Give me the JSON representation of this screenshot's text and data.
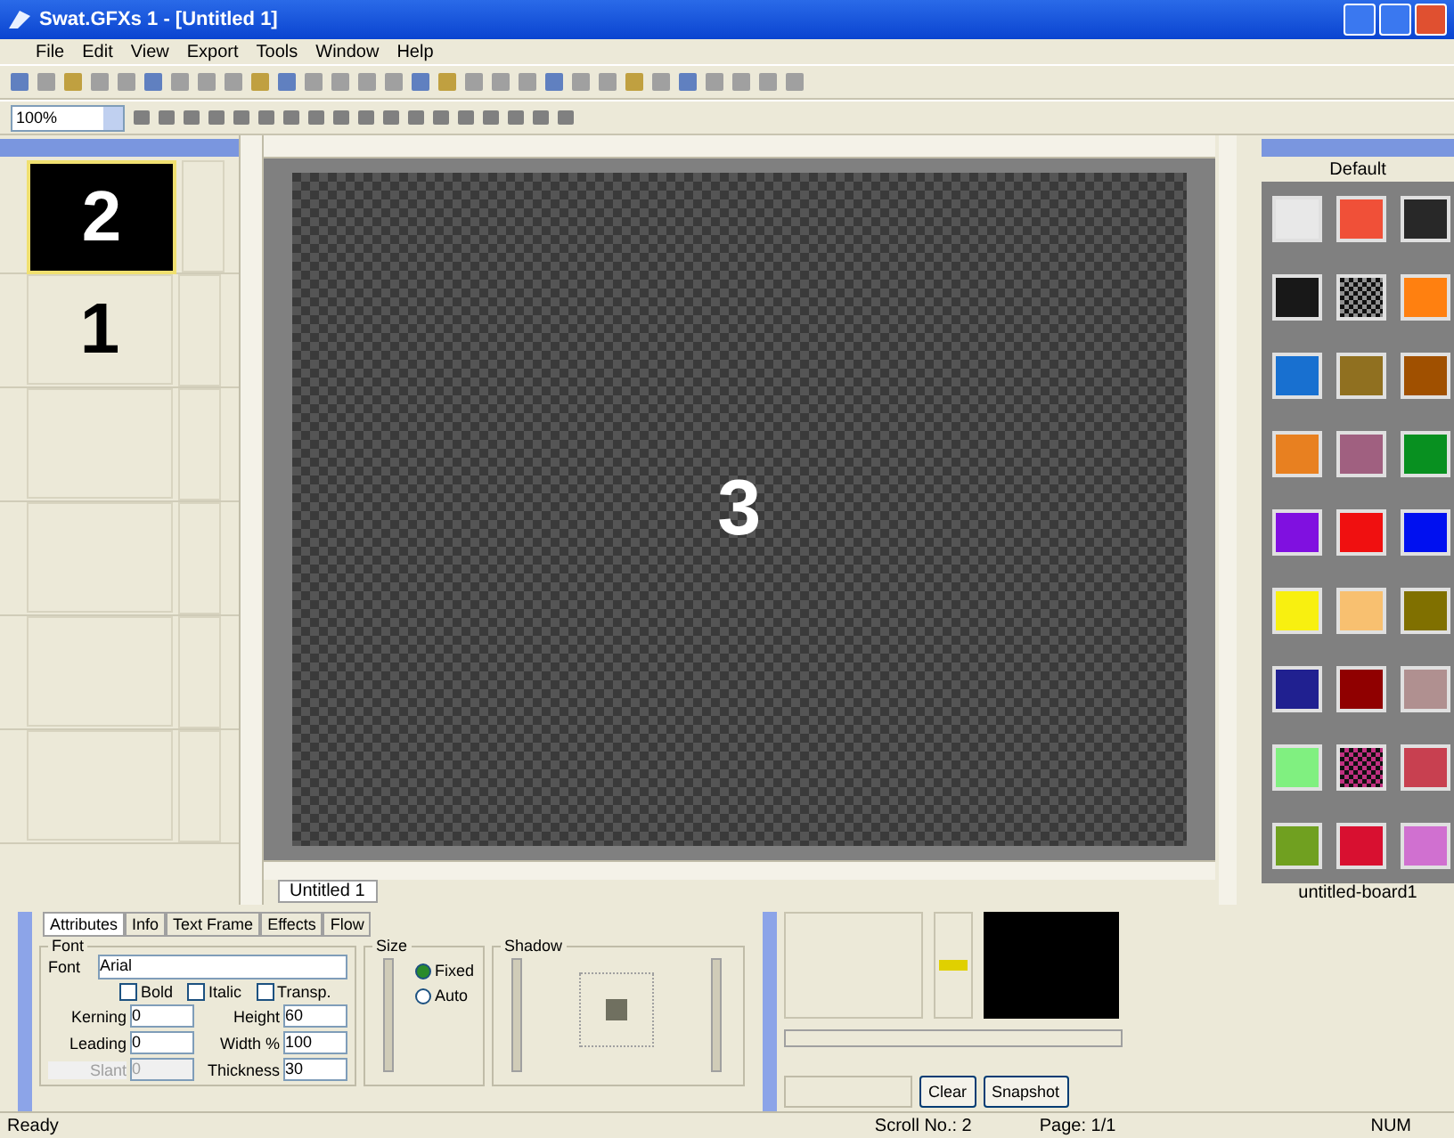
{
  "window": {
    "title": "Swat.GFXs 1 - [Untitled 1]"
  },
  "menu": [
    "File",
    "Edit",
    "View",
    "Export",
    "Tools",
    "Window",
    "Help"
  ],
  "zoom": {
    "value": "100%"
  },
  "scroll_list": [
    {
      "label": "2",
      "selected": true
    },
    {
      "label": "1",
      "selected": false
    },
    {
      "selected": false
    },
    {
      "selected": false
    },
    {
      "selected": false
    },
    {
      "selected": false
    }
  ],
  "canvas": {
    "label": "3"
  },
  "document_tab": "Untitled 1",
  "palette": {
    "header": "Default",
    "footer": "untitled-board1",
    "swatches": [
      {
        "kind": "solid",
        "color": "#e8e8e8"
      },
      {
        "kind": "solid",
        "color": "#f05038"
      },
      {
        "kind": "solid",
        "color": "#282828"
      },
      {
        "kind": "solid",
        "color": "#181818"
      },
      {
        "kind": "pattern",
        "color": "#909090"
      },
      {
        "kind": "solid",
        "color": "#ff8010"
      },
      {
        "kind": "solid",
        "color": "#1870d0"
      },
      {
        "kind": "solid",
        "color": "#907020"
      },
      {
        "kind": "solid",
        "color": "#a05000"
      },
      {
        "kind": "solid",
        "color": "#e88020"
      },
      {
        "kind": "solid",
        "color": "#a06080"
      },
      {
        "kind": "solid",
        "color": "#089020"
      },
      {
        "kind": "solid",
        "color": "#8010e0"
      },
      {
        "kind": "solid",
        "color": "#f01010"
      },
      {
        "kind": "solid",
        "color": "#0010f0"
      },
      {
        "kind": "solid",
        "color": "#f8f010"
      },
      {
        "kind": "solid",
        "color": "#f8c070"
      },
      {
        "kind": "solid",
        "color": "#807000"
      },
      {
        "kind": "solid",
        "color": "#202090"
      },
      {
        "kind": "solid",
        "color": "#900000"
      },
      {
        "kind": "solid",
        "color": "#b09090"
      },
      {
        "kind": "solid",
        "color": "#80f080"
      },
      {
        "kind": "pattern",
        "color": "#c03080"
      },
      {
        "kind": "solid",
        "color": "#c84050"
      },
      {
        "kind": "solid",
        "color": "#70a020"
      },
      {
        "kind": "solid",
        "color": "#d81030"
      },
      {
        "kind": "solid",
        "color": "#d070d0"
      }
    ]
  },
  "properties": {
    "tabs": [
      {
        "label": "Attributes",
        "selected": true
      },
      {
        "label": "Info",
        "selected": false
      },
      {
        "label": "Text Frame",
        "selected": false
      },
      {
        "label": "Effects",
        "selected": false
      },
      {
        "label": "Flow",
        "selected": false
      }
    ],
    "font_group": {
      "title": "Font",
      "font_label": "Font",
      "font_value": "Arial",
      "checkboxes": [
        {
          "label": "Bold",
          "checked": false
        },
        {
          "label": "Italic",
          "checked": false
        },
        {
          "label": "Transp.",
          "checked": false
        }
      ],
      "spinners": [
        {
          "label": "Kerning",
          "value": "0",
          "disabled": false
        },
        {
          "label": "Height",
          "value": "60",
          "disabled": false
        },
        {
          "label": "Leading",
          "value": "0",
          "disabled": false
        },
        {
          "label": "Width %",
          "value": "100",
          "disabled": false
        },
        {
          "label": "Slant",
          "value": "0",
          "disabled": true
        },
        {
          "label": "Thickness",
          "value": "30",
          "disabled": false
        }
      ]
    },
    "size_group": {
      "title": "Size",
      "radios": [
        {
          "label": "Fixed",
          "selected": true
        },
        {
          "label": "Auto",
          "selected": false
        }
      ]
    },
    "shadow_group": {
      "title": "Shadow"
    }
  },
  "preview": {
    "buttons": [
      "Clear",
      "Snapshot"
    ]
  },
  "status_bar": [
    "Ready",
    "Scroll No.: 2",
    "Page: 1/1",
    "NUM"
  ]
}
